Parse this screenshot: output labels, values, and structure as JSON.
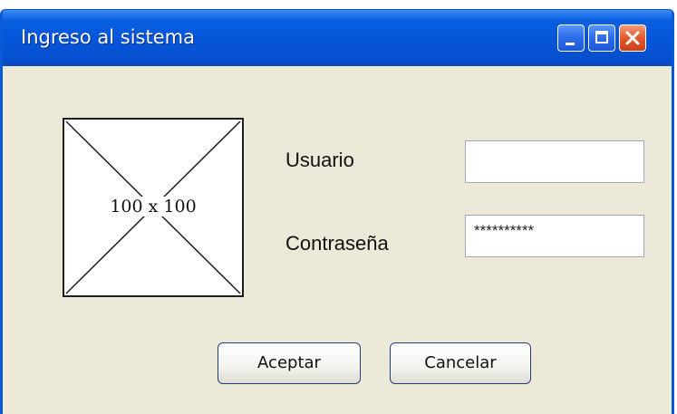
{
  "window": {
    "title": "Ingreso al sistema"
  },
  "titlebar_buttons": {
    "minimize_icon": "minimize-icon",
    "maximize_icon": "maximize-icon",
    "close_icon": "close-icon"
  },
  "image_placeholder": {
    "label": "100 x 100",
    "icon": "image-placeholder-cross"
  },
  "form": {
    "username_label": "Usuario",
    "username_value": "",
    "password_label": "Contraseña",
    "password_value": "**********"
  },
  "buttons": {
    "accept_label": "Aceptar",
    "cancel_label": "Cancelar"
  },
  "colors": {
    "titlebar_blue": "#0556DA",
    "window_background": "#ECE9D8",
    "close_button_red": "#E45A2E"
  }
}
